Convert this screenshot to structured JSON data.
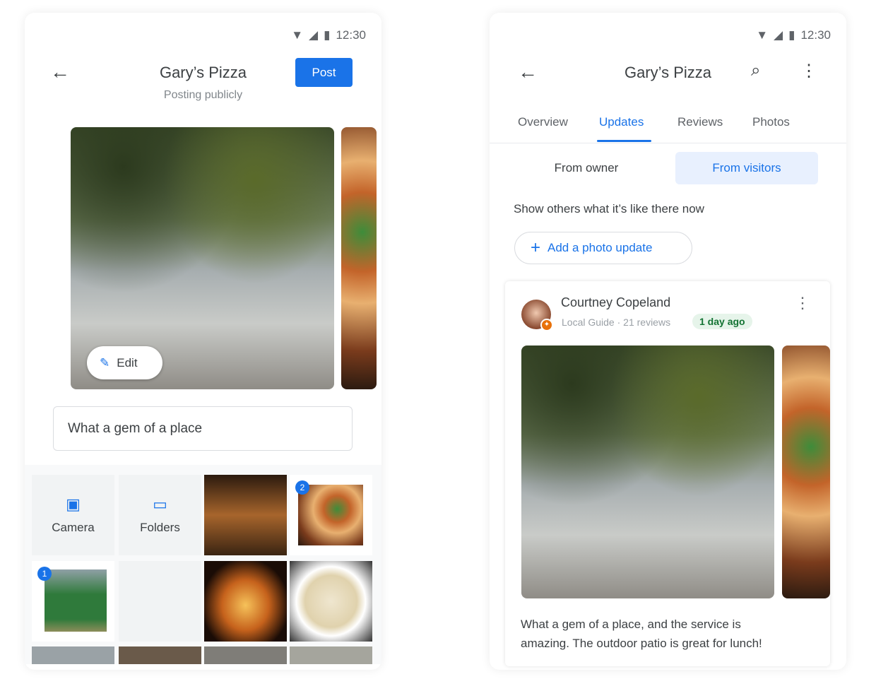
{
  "status_bar": {
    "time": "12:30"
  },
  "left": {
    "title": "Gary’s Pizza",
    "subtitle": "Posting publicly",
    "post_label": "Post",
    "edit_label": "Edit",
    "caption_value": "What a gem of a place",
    "picker": {
      "camera_label": "Camera",
      "folders_label": "Folders",
      "selected_badges": [
        "2",
        "1"
      ]
    }
  },
  "right": {
    "title": "Gary’s Pizza",
    "tabs": [
      "Overview",
      "Updates",
      "Reviews",
      "Photos"
    ],
    "active_tab": "Updates",
    "segments": [
      "From owner",
      "From visitors"
    ],
    "active_segment": "From visitors",
    "prompt": "Show others what it’s like there now",
    "add_photo_label": "Add a photo update",
    "post": {
      "author": "Courtney Copeland",
      "meta": "Local Guide · 21 reviews",
      "age": "1 day ago",
      "text_line1": "What a gem of a place, and the service is",
      "text_line2": "amazing. The outdoor patio is great for lunch!"
    }
  },
  "colors": {
    "accent": "#1a73e8",
    "active_segment_bg": "#e8f0fe",
    "age_badge_bg": "#e6f4ea",
    "age_badge_text": "#137333"
  }
}
